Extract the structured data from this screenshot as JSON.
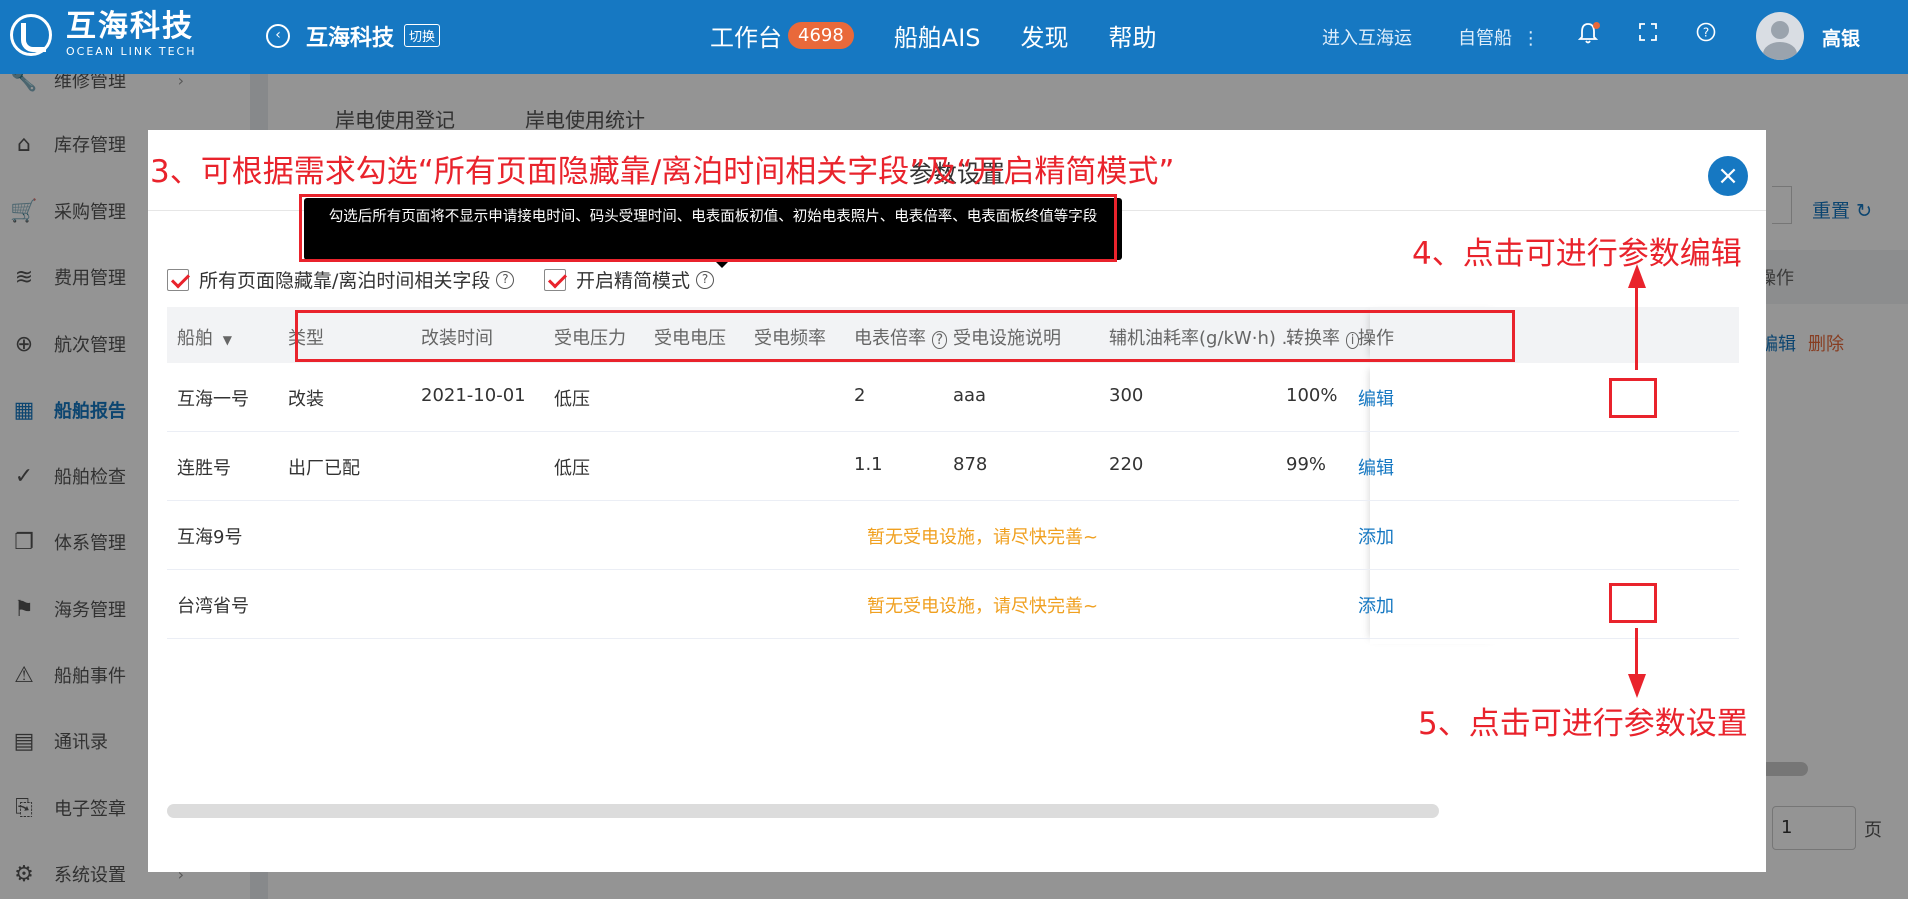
{
  "header": {
    "logo_cn": "互海科技",
    "logo_en": "OCEAN LINK TECH",
    "company": "互海科技",
    "switch_label": "切换",
    "nav": [
      {
        "label": "工作台",
        "badge": "4698"
      },
      {
        "label": "船舶AIS"
      },
      {
        "label": "发现"
      },
      {
        "label": "帮助"
      }
    ],
    "enter_link": "进入互海运",
    "self_manage": "自管船",
    "user_name": "高银"
  },
  "sidebar": {
    "items": [
      {
        "label": "维修管理",
        "icon": "wrench-icon"
      },
      {
        "label": "库存管理",
        "icon": "home-icon"
      },
      {
        "label": "采购管理",
        "icon": "cart-icon"
      },
      {
        "label": "费用管理",
        "icon": "database-icon"
      },
      {
        "label": "航次管理",
        "icon": "globe-icon"
      },
      {
        "label": "船舶报告",
        "icon": "calendar-icon",
        "active": true
      },
      {
        "label": "船舶检查",
        "icon": "check-circle-icon"
      },
      {
        "label": "体系管理",
        "icon": "document-icon"
      },
      {
        "label": "海务管理",
        "icon": "signpost-icon"
      },
      {
        "label": "船舶事件",
        "icon": "warning-icon"
      },
      {
        "label": "通讯录",
        "icon": "server-icon"
      },
      {
        "label": "电子签章",
        "icon": "seal-icon"
      },
      {
        "label": "系统设置",
        "icon": "gear-icon"
      }
    ]
  },
  "background": {
    "tabs": [
      "岸电使用登记",
      "岸电使用统计"
    ],
    "reset_label": "重置",
    "op_header": "操作",
    "edit": "编辑",
    "delete": "删除",
    "page_value": "1",
    "page_unit": "页"
  },
  "modal": {
    "title": "参数设置",
    "tooltip": "勾选后所有页面将不显示申请接电时间、码头受理时间、电表面板初值、初始电表照片、电表倍率、电表面板终值等字段",
    "checkbox_hide": "所有页面隐藏靠/离泊时间相关字段",
    "checkbox_simple": "开启精简模式",
    "columns": [
      "船舶",
      "类型",
      "改装时间",
      "受电压力",
      "受电电压",
      "受电频率",
      "电表倍率",
      "受电设施说明",
      "辅机油耗率(g/kW·h) ...",
      "转换率",
      "操作"
    ],
    "rows": [
      {
        "ship": "互海一号",
        "type": "改装",
        "date": "2021-10-01",
        "pressure": "低压",
        "voltage": "",
        "freq": "",
        "ratio": "2",
        "desc": "aaa",
        "fuel": "300",
        "conv": "100%",
        "action": "编辑"
      },
      {
        "ship": "连胜号",
        "type": "出厂已配",
        "date": "",
        "pressure": "低压",
        "voltage": "",
        "freq": "",
        "ratio": "1.1",
        "desc": "878",
        "fuel": "220",
        "conv": "99%",
        "action": "编辑"
      },
      {
        "ship": "互海9号",
        "empty_msg": "暂无受电设施，请尽快完善~",
        "action": "添加"
      },
      {
        "ship": "台湾省号",
        "empty_msg": "暂无受电设施，请尽快完善~",
        "action": "添加"
      }
    ]
  },
  "annotations": {
    "step3": "3、可根据需求勾选“所有页面隐藏靠/离泊时间相关字段”及“开启精简模式”",
    "step4": "4、点击可进行参数编辑",
    "step5": "5、点击可进行参数设置"
  },
  "colors": {
    "primary": "#1678c2",
    "annotation": "#e9232c",
    "warning": "#f0a020",
    "badge": "#e9693a"
  }
}
